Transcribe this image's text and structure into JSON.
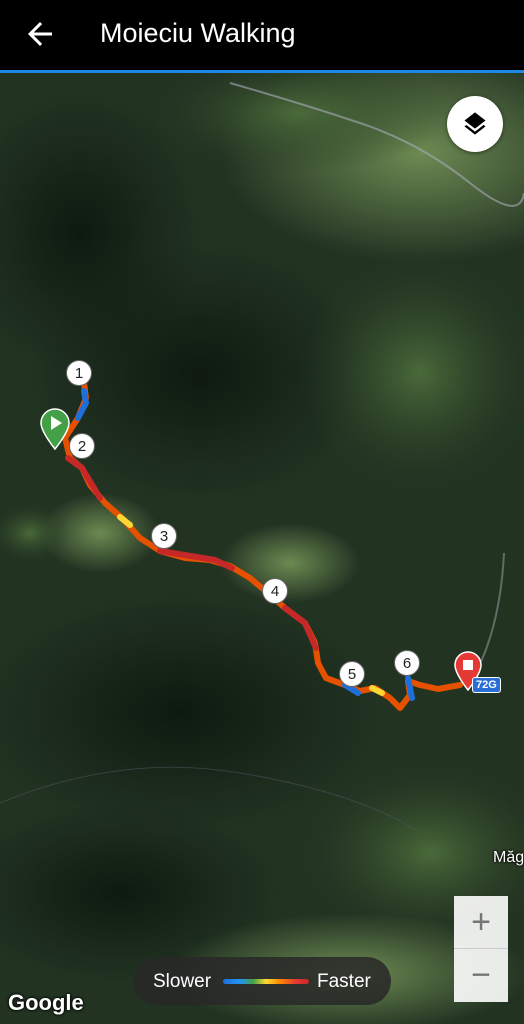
{
  "app_bar": {
    "title": "Moieciu Walking",
    "back_icon": "arrow-back-icon"
  },
  "map": {
    "layers_icon": "layers-icon",
    "km_markers": [
      "1",
      "2",
      "3",
      "4",
      "5",
      "6"
    ],
    "start_icon": "start-flag-icon",
    "finish_icon": "finish-pin-icon",
    "road_label": "72G",
    "place_label": "Măg",
    "zoom_in": "+",
    "zoom_out": "−",
    "attribution": "Google"
  },
  "legend": {
    "slower": "Slower",
    "faster": "Faster"
  },
  "colors": {
    "accent": "#1e88e5",
    "start": "#43a047",
    "finish": "#e53935",
    "fast": "#c62828",
    "slow": "#1e6fd9"
  }
}
